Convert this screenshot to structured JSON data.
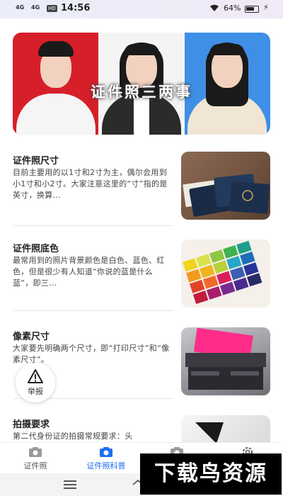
{
  "status_bar": {
    "signal_1": "4G",
    "signal_2": "4G",
    "hd": "HD",
    "time": "14:56",
    "battery": "64%"
  },
  "banner": {
    "title": "证件照三两事"
  },
  "articles": [
    {
      "title": "证件照尺寸",
      "desc": "目前主要用的以1寸和2寸为主，偶尔会用到小1寸和小2寸。大家注意这里的“寸”指的是英寸，换算…"
    },
    {
      "title": "证件照底色",
      "desc": "最常用到的照片背景颜色是白色、蓝色、红色，但是很少有人知道“你说的蓝是什么蓝”，即三…"
    },
    {
      "title": "像素尺寸",
      "desc": "大家要先明确两个尺寸，即“打印尺寸”和“像素尺寸”。"
    },
    {
      "title": "拍摄要求",
      "desc": "第二代身份证的拍摄常规要求：头"
    }
  ],
  "report": {
    "label": "举报"
  },
  "tabs": [
    {
      "label": "证件照",
      "active": false
    },
    {
      "label": "证件照科普",
      "active": true
    },
    {
      "label": "",
      "active": false
    },
    {
      "label": "",
      "active": false
    }
  ],
  "watermark": "下载鸟资源",
  "colors": {
    "accent": "#1f6ef2",
    "banner_red": "#d71f2a",
    "banner_blue": "#3f8fe6"
  }
}
